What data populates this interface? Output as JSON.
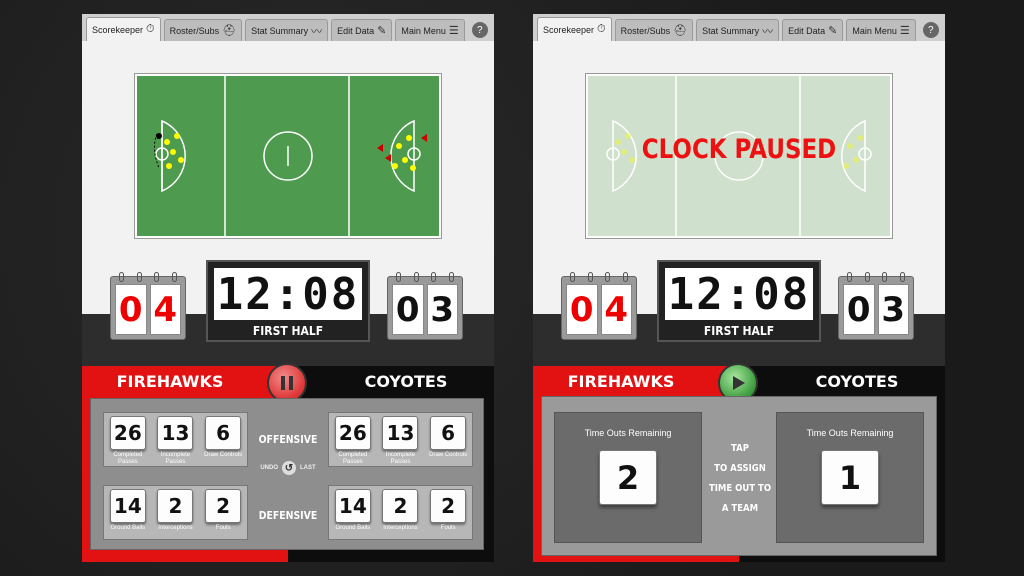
{
  "tabs": [
    {
      "label": "Scorekeeper",
      "icon": "stopwatch-icon"
    },
    {
      "label": "Roster/Subs",
      "icon": "helmet-icon"
    },
    {
      "label": "Stat Summary",
      "icon": "chart-icon"
    },
    {
      "label": "Edit Data",
      "icon": "edit-icon"
    },
    {
      "label": "Main Menu",
      "icon": "list-icon"
    }
  ],
  "help_label": "?",
  "left": {
    "home_score": [
      "0",
      "4"
    ],
    "away_score": [
      "0",
      "3"
    ],
    "clock": "12:08",
    "period": "FIRST HALF",
    "home_team": "FIREHAWKS",
    "away_team": "COYOTES",
    "offensive_label": "OFFENSIVE",
    "defensive_label": "DEFENSIVE",
    "undo_label": "UNDO",
    "last_label": "LAST",
    "home_offensive": [
      {
        "value": "26",
        "label": "Completed Passes"
      },
      {
        "value": "13",
        "label": "Incomplete Passes"
      },
      {
        "value": "6",
        "label": "Draw Controls"
      }
    ],
    "away_offensive": [
      {
        "value": "26",
        "label": "Completed Passes"
      },
      {
        "value": "13",
        "label": "Incomplete Passes"
      },
      {
        "value": "6",
        "label": "Draw Controls"
      }
    ],
    "home_defensive": [
      {
        "value": "14",
        "label": "Ground Balls"
      },
      {
        "value": "2",
        "label": "Interceptions"
      },
      {
        "value": "2",
        "label": "Fouls"
      }
    ],
    "away_defensive": [
      {
        "value": "14",
        "label": "Ground Balls"
      },
      {
        "value": "2",
        "label": "Interceptions"
      },
      {
        "value": "2",
        "label": "Fouls"
      }
    ]
  },
  "right": {
    "home_score": [
      "0",
      "4"
    ],
    "away_score": [
      "0",
      "3"
    ],
    "clock": "12:08",
    "period": "FIRST HALF",
    "home_team": "FIREHAWKS",
    "away_team": "COYOTES",
    "paused_message": "CLOCK PAUSED",
    "timeouts_label": "Time Outs Remaining",
    "home_timeouts": "2",
    "away_timeouts": "1",
    "tap_line1": "TAP",
    "tap_line2": "TO ASSIGN",
    "tap_line3": "TIME OUT TO",
    "tap_line4": "A TEAM"
  },
  "colors": {
    "home": "#e31212",
    "away": "#0d0d0d",
    "field": "#4e9a4e",
    "pause_button": "#d33",
    "play_button": "#3a9a3a"
  }
}
